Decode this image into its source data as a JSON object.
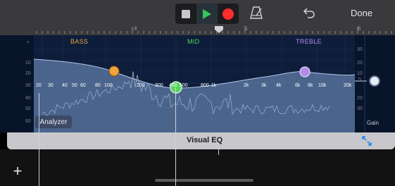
{
  "toolbar": {
    "done_label": "Done"
  },
  "ruler": {
    "markers": [
      "4",
      "5",
      "6"
    ]
  },
  "eq": {
    "bands": {
      "bass": "BASS",
      "mid": "MID",
      "treble": "TREBLE"
    },
    "freq_labels": [
      "20",
      "30",
      "40",
      "50",
      "60",
      "80",
      "100",
      "200",
      "300",
      "400",
      "500",
      "800",
      "1k",
      "2k",
      "3k",
      "4k",
      "6k",
      "8k",
      "10k",
      "20k"
    ],
    "db_left": [
      "+",
      "10",
      "20",
      "30",
      "40",
      "50",
      "60"
    ],
    "db_right": [
      "30",
      "20",
      "10",
      "5",
      "20",
      "30"
    ],
    "analyzer_label": "Analyzer",
    "gain_label": "Gain",
    "colors": {
      "bass": "#f0a33b",
      "mid": "#53d65a",
      "treble": "#b38be6"
    }
  },
  "panel": {
    "title": "Visual EQ"
  },
  "icons": [
    "stop-icon",
    "play-icon",
    "record-icon",
    "metronome-icon",
    "undo-icon",
    "expand-icon",
    "add-icon"
  ]
}
